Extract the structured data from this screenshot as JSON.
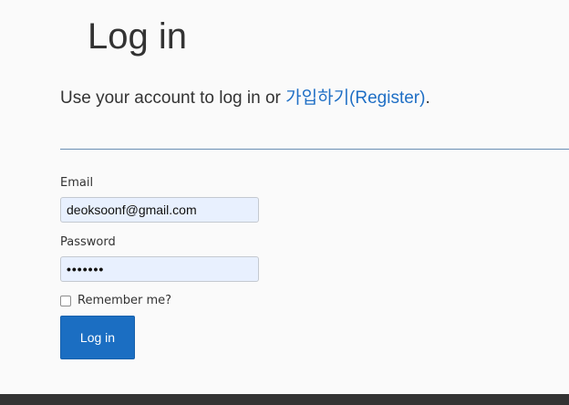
{
  "page": {
    "title": "Log in",
    "intro_prefix": "Use your account to log in or ",
    "register_link": "가입하기(Register)",
    "intro_suffix": "."
  },
  "form": {
    "email_label": "Email",
    "email_value": "deoksoonf@gmail.com",
    "password_label": "Password",
    "password_value": "•••••••",
    "remember_label": "Remember me?",
    "remember_checked": false,
    "submit_label": "Log in"
  },
  "colors": {
    "link": "#1f6fc5",
    "button": "#1b6ec2",
    "input_background": "#e8f0fe"
  }
}
